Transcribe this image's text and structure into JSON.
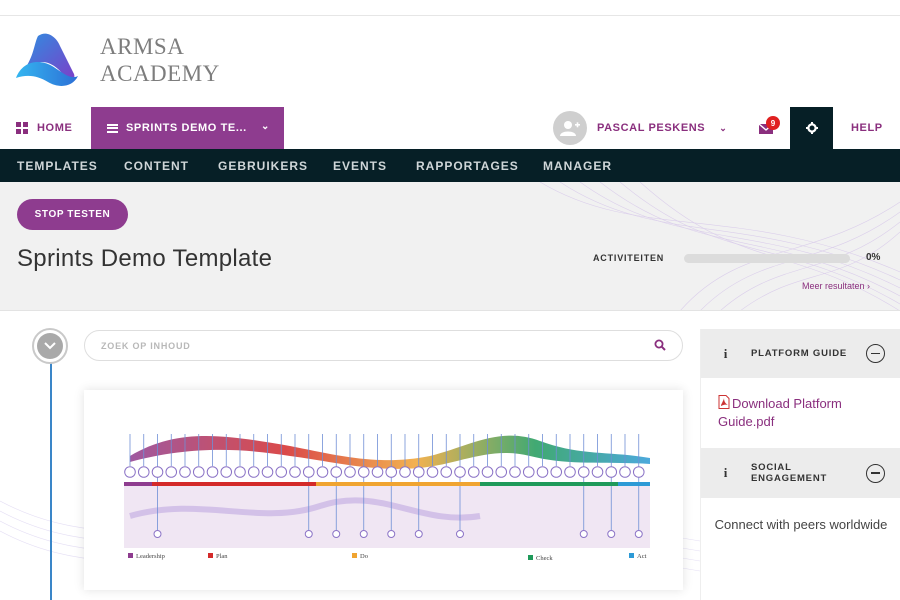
{
  "brand": {
    "line1": "ARMSA",
    "line2": "ACADEMY"
  },
  "nav": {
    "home_label": "HOME",
    "course_label": "SPRINTS DEMO TE...",
    "user_name": "PASCAL PESKENS",
    "mail_count": "9",
    "help_label": "HELP"
  },
  "subnav": {
    "items": [
      "TEMPLATES",
      "CONTENT",
      "GEBRUIKERS",
      "EVENTS",
      "RAPPORTAGES",
      "MANAGER"
    ]
  },
  "header": {
    "stop_label": "STOP TESTEN",
    "title": "Sprints Demo Template",
    "activities_label": "ACTIVITEITEN",
    "activities_progress": 0,
    "activities_pct": "0%",
    "more_results": "Meer resultaten"
  },
  "search": {
    "placeholder": "ZOEK OP INHOUD"
  },
  "diagram": {
    "legend": [
      "Leadership",
      "Plan",
      "Do",
      "Check",
      "Act"
    ]
  },
  "sidebar": {
    "guide_title": "PLATFORM GUIDE",
    "guide_link": "Download Platform Guide.pdf",
    "social_title_1": "SOCIAL",
    "social_title_2": "ENGAGEMENT",
    "social_text": "Connect with peers worldwide"
  },
  "colors": {
    "accent": "#8e3c8f",
    "dark": "#061f26",
    "progress_track": "#dcdcdc",
    "leadership": "#8e3c8f",
    "plan": "#d42a2a",
    "do": "#f0a431",
    "check": "#1f9a5a",
    "act": "#2d9ad6"
  }
}
